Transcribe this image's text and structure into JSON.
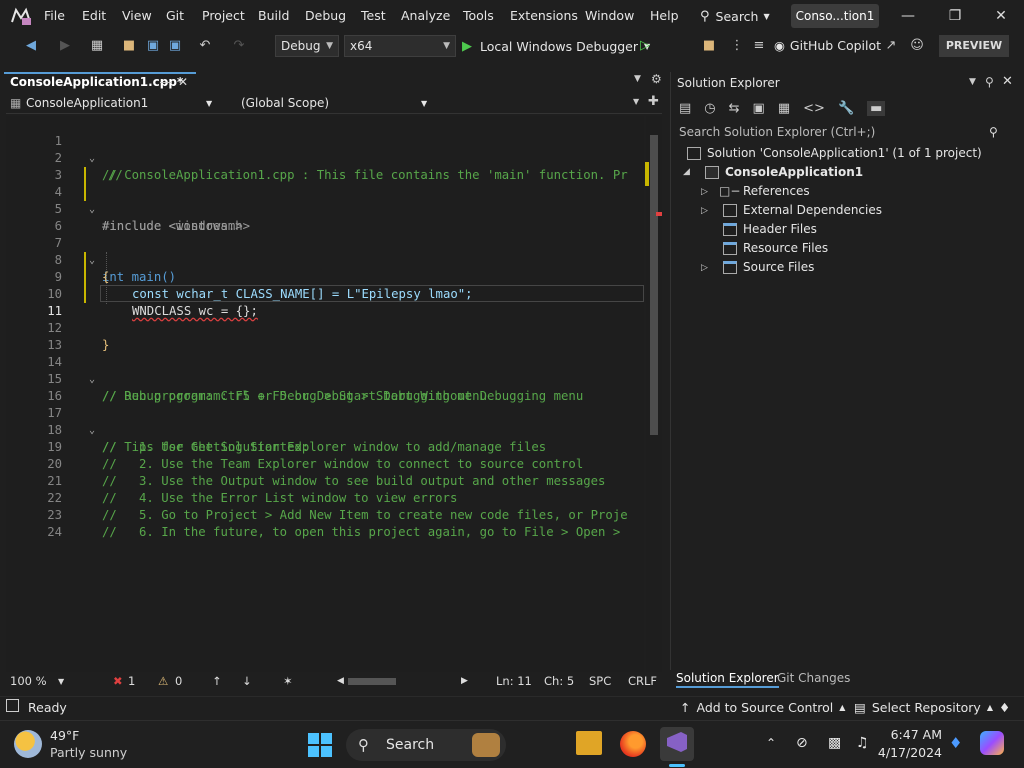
{
  "menu": {
    "items": [
      "File",
      "Edit",
      "View",
      "Git",
      "Project",
      "Build",
      "Debug",
      "Test",
      "Analyze",
      "Tools",
      "Extensions",
      "Window",
      "Help"
    ],
    "search_label": "Search",
    "title": "Conso...tion1"
  },
  "toolbar": {
    "config": "Debug",
    "platform": "x64",
    "run_label": "Local Windows Debugger",
    "copilot_label": "GitHub Copilot",
    "preview_label": "PREVIEW"
  },
  "document": {
    "tab_label": "ConsoleApplication1.cpp*",
    "nav_project": "ConsoleApplication1",
    "nav_scope": "(Global Scope)"
  },
  "code_lines": [
    {
      "n": "1",
      "text": "// ConsoleApplication1.cpp : This file contains the 'main' function. Pr"
    },
    {
      "n": "2",
      "text": "//"
    },
    {
      "n": "3",
      "text": ""
    },
    {
      "n": "4",
      "text": "#include <iostream>"
    },
    {
      "n": "5",
      "text": "#include <windows.h>"
    },
    {
      "n": "6",
      "text": ""
    },
    {
      "n": "7",
      "text": "int main()"
    },
    {
      "n": "8",
      "text": "{"
    },
    {
      "n": "9",
      "text": "const wchar_t CLASS_NAME[] = L\"Epilepsy lmao\";"
    },
    {
      "n": "10",
      "text": "WNDCLASS wc = {};"
    },
    {
      "n": "11",
      "text": ""
    },
    {
      "n": "12",
      "text": "}"
    },
    {
      "n": "13",
      "text": ""
    },
    {
      "n": "14",
      "text": "// Run program: Ctrl + F5 or Debug > Start Without Debugging menu"
    },
    {
      "n": "15",
      "text": "// Debug program: F5 or Debug > Start Debugging menu"
    },
    {
      "n": "16",
      "text": ""
    },
    {
      "n": "17",
      "text": "// Tips for Getting Started:"
    },
    {
      "n": "18",
      "text": "//   1. Use the Solution Explorer window to add/manage files"
    },
    {
      "n": "19",
      "text": "//   2. Use the Team Explorer window to connect to source control"
    },
    {
      "n": "20",
      "text": "//   3. Use the Output window to see build output and other messages"
    },
    {
      "n": "21",
      "text": "//   4. Use the Error List window to view errors"
    },
    {
      "n": "22",
      "text": "//   5. Go to Project > Add New Item to create new code files, or Proje"
    },
    {
      "n": "23",
      "text": "//   6. In the future, to open this project again, go to File > Open >"
    },
    {
      "n": "24",
      "text": ""
    }
  ],
  "editor_status": {
    "zoom": "100 %",
    "errors": "1",
    "warnings": "0",
    "line": "Ln: 11",
    "col": "Ch: 5",
    "spc": "SPC",
    "eol": "CRLF"
  },
  "solution_explorer": {
    "title": "Solution Explorer",
    "search_placeholder": "Search Solution Explorer (Ctrl+;)",
    "solution": "Solution 'ConsoleApplication1' (1 of 1 project)",
    "project": "ConsoleApplication1",
    "nodes": [
      "References",
      "External Dependencies",
      "Header Files",
      "Resource Files",
      "Source Files"
    ],
    "tab_active": "Solution Explorer",
    "tab_other": "Git Changes"
  },
  "statusbar": {
    "ready": "Ready",
    "source_control": "Add to Source Control",
    "repository": "Select Repository"
  },
  "taskbar": {
    "temp": "49°F",
    "weather": "Partly sunny",
    "search": "Search",
    "time": "6:47 AM",
    "date": "4/17/2024"
  },
  "colors": {
    "accent": "#569cd6",
    "comment": "#57a64a",
    "keyword": "#569cd6",
    "string": "#d69d85",
    "type": "#4ec9b0"
  }
}
